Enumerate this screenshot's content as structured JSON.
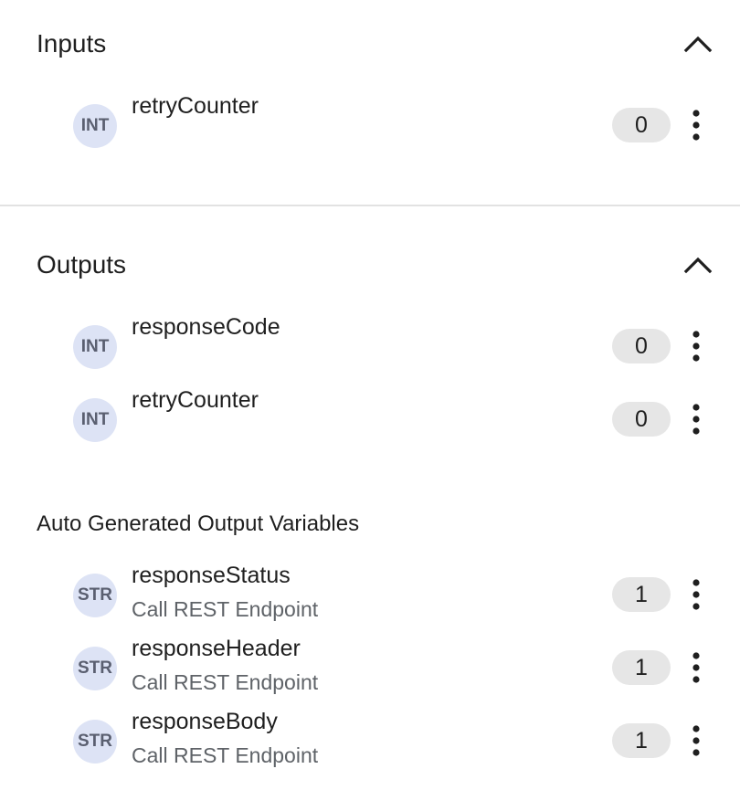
{
  "inputs": {
    "title": "Inputs",
    "items": [
      {
        "type": "INT",
        "name": "retryCounter",
        "count": "0"
      }
    ]
  },
  "outputs": {
    "title": "Outputs",
    "items": [
      {
        "type": "INT",
        "name": "responseCode",
        "count": "0"
      },
      {
        "type": "INT",
        "name": "retryCounter",
        "count": "0"
      }
    ]
  },
  "auto_generated": {
    "title": "Auto Generated Output Variables",
    "items": [
      {
        "type": "STR",
        "name": "responseStatus",
        "source": "Call REST Endpoint",
        "count": "1"
      },
      {
        "type": "STR",
        "name": "responseHeader",
        "source": "Call REST Endpoint",
        "count": "1"
      },
      {
        "type": "STR",
        "name": "responseBody",
        "source": "Call REST Endpoint",
        "count": "1"
      }
    ]
  },
  "icons": {
    "collapse": "chevron-up-icon",
    "more": "more-vertical-icon"
  }
}
